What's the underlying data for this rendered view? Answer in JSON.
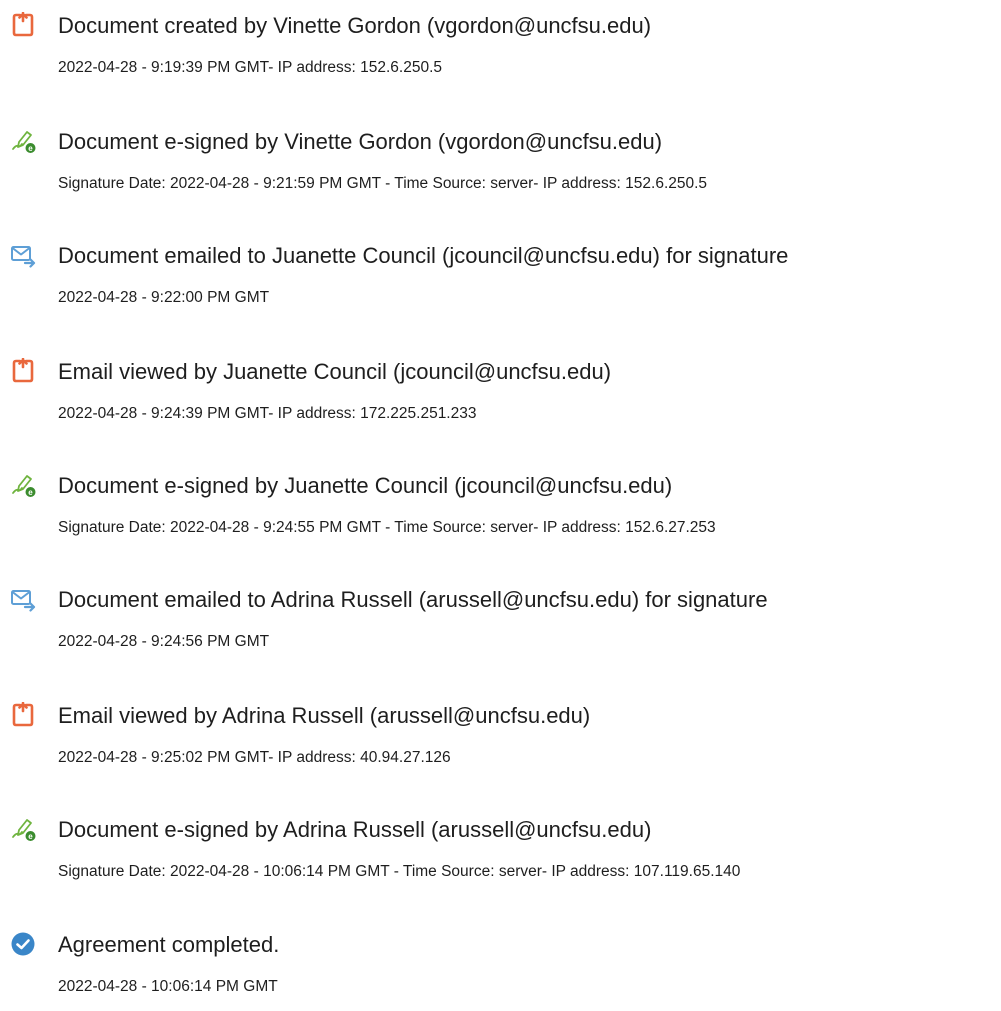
{
  "colors": {
    "created_icon": "#e9683d",
    "signed_icon_pen": "#6fb43f",
    "signed_icon_badge": "#3b8c2e",
    "emailed_icon": "#5e9fd6",
    "completed_icon": "#3a86c8",
    "text": "#1e1e1e"
  },
  "events": [
    {
      "icon": "document-created-icon",
      "title": "Document created by Vinette Gordon (vgordon@uncfsu.edu)",
      "detail": "2022-04-28 - 9:19:39 PM GMT- IP address: 152.6.250.5"
    },
    {
      "icon": "e-signed-pen-icon",
      "title": "Document e-signed by Vinette Gordon (vgordon@uncfsu.edu)",
      "detail": "Signature Date: 2022-04-28 - 9:21:59 PM GMT - Time Source: server- IP address: 152.6.250.5"
    },
    {
      "icon": "email-sent-icon",
      "title": "Document emailed to Juanette Council (jcouncil@uncfsu.edu) for signature",
      "detail": "2022-04-28 - 9:22:00 PM GMT"
    },
    {
      "icon": "email-viewed-icon",
      "title": "Email viewed by Juanette Council (jcouncil@uncfsu.edu)",
      "detail": "2022-04-28 - 9:24:39 PM GMT- IP address: 172.225.251.233"
    },
    {
      "icon": "e-signed-pen-icon",
      "title": "Document e-signed by Juanette Council (jcouncil@uncfsu.edu)",
      "detail": "Signature Date: 2022-04-28 - 9:24:55 PM GMT - Time Source: server- IP address: 152.6.27.253"
    },
    {
      "icon": "email-sent-icon",
      "title": "Document emailed to Adrina Russell (arussell@uncfsu.edu) for signature",
      "detail": "2022-04-28 - 9:24:56 PM GMT"
    },
    {
      "icon": "email-viewed-icon",
      "title": "Email viewed by Adrina Russell (arussell@uncfsu.edu)",
      "detail": "2022-04-28 - 9:25:02 PM GMT- IP address: 40.94.27.126"
    },
    {
      "icon": "e-signed-pen-icon",
      "title": "Document e-signed by Adrina Russell (arussell@uncfsu.edu)",
      "detail": "Signature Date: 2022-04-28 - 10:06:14 PM GMT - Time Source: server- IP address: 107.119.65.140"
    },
    {
      "icon": "check-circle-icon",
      "title": "Agreement completed.",
      "detail": "2022-04-28 - 10:06:14 PM GMT"
    }
  ]
}
